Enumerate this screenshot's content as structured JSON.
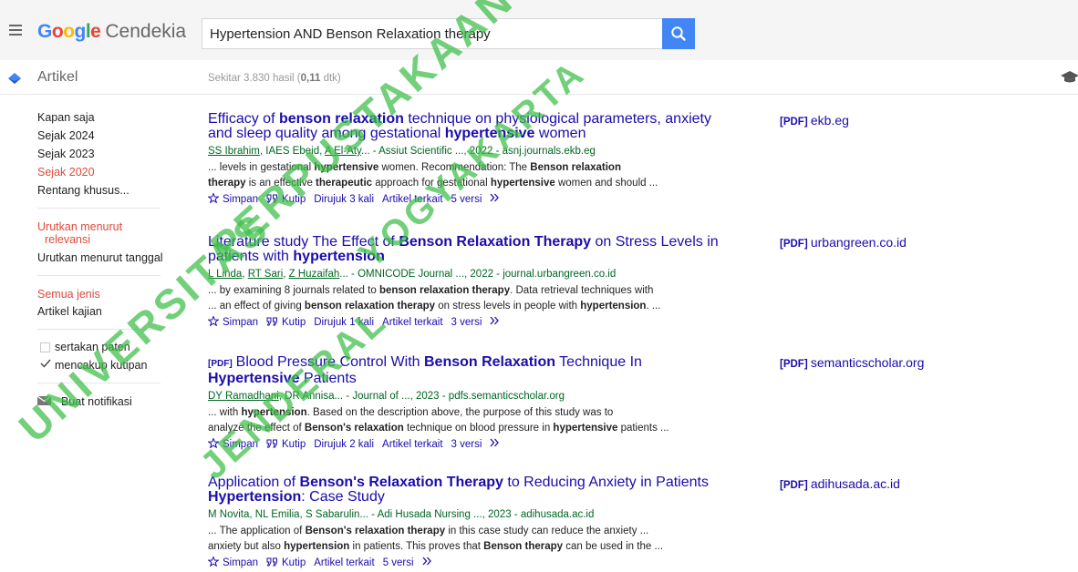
{
  "header": {
    "logo_text": "Google",
    "logo_suffix": "Cendekia",
    "search_value": "Hypertension AND Benson Relaxation therapy"
  },
  "subheader": {
    "section_label": "Artikel",
    "stats_prefix": "Sekitar 3.830 hasil (",
    "stats_time": "0,11",
    "stats_suffix": " dtk)"
  },
  "sidebar": {
    "time_filters": [
      "Kapan saja",
      "Sejak 2024",
      "Sejak 2023",
      "Sejak 2020",
      "Rentang khusus..."
    ],
    "sort_relevance_line1": "Urutkan menurut",
    "sort_relevance_line2": "relevansi",
    "sort_date": "Urutkan menurut tanggal",
    "type_all": "Semua jenis",
    "type_review": "Artikel kajian",
    "include_patents": "sertakan paten",
    "include_citations": "mencakup kutipan",
    "create_alert": "Buat notifikasi"
  },
  "watermark": {
    "line1": "UNIVERSITAS",
    "line2": "JENDERAL",
    "line3": "YOGYAKARTA",
    "line4": "PERPUSTAKAAN"
  },
  "results": [
    {
      "title_parts": [
        {
          "t": "Efficacy of ",
          "b": false
        },
        {
          "t": "benson relaxation",
          "b": true
        },
        {
          "t": " technique on physiological parameters, anxiety",
          "b": false
        }
      ],
      "title_line2_parts": [
        {
          "t": "and sleep quality among gestational ",
          "b": false
        },
        {
          "t": "hypertensive",
          "b": true
        },
        {
          "t": " women",
          "b": false
        }
      ],
      "authors": [
        "SS Ibrahim",
        "IAES Ebeid",
        "A El-Aty"
      ],
      "authors_rest": "... - Assiut Scientific ..., 2022 - asnj.journals.ekb.eg",
      "authors_linked": [
        true,
        false,
        true
      ],
      "snippet_line1": [
        {
          "t": "... levels in gestational ",
          "b": false
        },
        {
          "t": "hypertensive",
          "b": true
        },
        {
          "t": " women. Recommendation: The ",
          "b": false
        },
        {
          "t": "Benson relaxation",
          "b": true
        }
      ],
      "snippet_line2": [
        {
          "t": "therapy",
          "b": true
        },
        {
          "t": " is an effective ",
          "b": false
        },
        {
          "t": "therapeutic",
          "b": true
        },
        {
          "t": " approach for gestational ",
          "b": false
        },
        {
          "t": "hypertensive",
          "b": true
        },
        {
          "t": " women and should ...",
          "b": false
        }
      ],
      "actions": {
        "save": "Simpan",
        "cite": "Kutip",
        "cited_by": "Dirujuk 3 kali",
        "related": "Artikel terkait",
        "versions": "5 versi"
      },
      "side_tag": "[PDF]",
      "side_domain": "ekb.eg",
      "pdf_prefix": ""
    },
    {
      "title_parts": [
        {
          "t": "Literature study The Effect of ",
          "b": false
        },
        {
          "t": "Benson Relaxation Therapy",
          "b": true
        },
        {
          "t": " on Stress Levels in",
          "b": false
        }
      ],
      "title_line2_parts": [
        {
          "t": "patients with ",
          "b": false
        },
        {
          "t": "hypertension",
          "b": true
        }
      ],
      "authors": [
        "L Linda",
        "RT Sari",
        "Z Huzaifah"
      ],
      "authors_rest": "... - OMNICODE Journal ..., 2022 - journal.urbangreen.co.id",
      "authors_linked": [
        true,
        true,
        true
      ],
      "snippet_line1": [
        {
          "t": "... by examining 8 journals related to ",
          "b": false
        },
        {
          "t": "benson relaxation therapy",
          "b": true
        },
        {
          "t": ". Data retrieval techniques with",
          "b": false
        }
      ],
      "snippet_line2": [
        {
          "t": "... an effect of giving ",
          "b": false
        },
        {
          "t": "benson relaxation therapy",
          "b": true
        },
        {
          "t": " on stress levels in people with ",
          "b": false
        },
        {
          "t": "hypertension",
          "b": true
        },
        {
          "t": ". ...",
          "b": false
        }
      ],
      "actions": {
        "save": "Simpan",
        "cite": "Kutip",
        "cited_by": "Dirujuk 1 kali",
        "related": "Artikel terkait",
        "versions": "3 versi"
      },
      "side_tag": "[PDF]",
      "side_domain": "urbangreen.co.id",
      "pdf_prefix": ""
    },
    {
      "title_parts": [
        {
          "t": "Blood Pressure Control With ",
          "b": false
        },
        {
          "t": "Benson Relaxation",
          "b": true
        },
        {
          "t": " Technique In",
          "b": false
        }
      ],
      "title_line2_parts": [
        {
          "t": "Hypertensive",
          "b": true
        },
        {
          "t": " Patients",
          "b": false
        }
      ],
      "authors": [
        "DY Ramadhani",
        "DR Annisa"
      ],
      "authors_rest": "... - Journal of ..., 2023 - pdfs.semanticscholar.org",
      "authors_linked": [
        true,
        false
      ],
      "snippet_line1": [
        {
          "t": "... with ",
          "b": false
        },
        {
          "t": "hypertension",
          "b": true
        },
        {
          "t": ". Based on the description above, the purpose of this study was to",
          "b": false
        }
      ],
      "snippet_line2": [
        {
          "t": "analyze the effect of ",
          "b": false
        },
        {
          "t": "Benson's relaxation",
          "b": true
        },
        {
          "t": " technique on blood pressure in ",
          "b": false
        },
        {
          "t": "hypertensive",
          "b": true
        },
        {
          "t": " patients ...",
          "b": false
        }
      ],
      "actions": {
        "save": "Simpan",
        "cite": "Kutip",
        "cited_by": "Dirujuk 2 kali",
        "related": "Artikel terkait",
        "versions": "3 versi"
      },
      "side_tag": "[PDF]",
      "side_domain": "semanticscholar.org",
      "pdf_prefix": "[PDF]"
    },
    {
      "title_parts": [
        {
          "t": "Application of ",
          "b": false
        },
        {
          "t": "Benson's Relaxation Therapy",
          "b": true
        },
        {
          "t": " to Reducing Anxiety in Patients",
          "b": false
        }
      ],
      "title_line2_parts": [
        {
          "t": "Hypertension",
          "b": true
        },
        {
          "t": ": Case Study",
          "b": false
        }
      ],
      "authors": [
        "M Novita",
        "NL Emilia",
        "S Sabarulin"
      ],
      "authors_rest": "... - Adi Husada Nursing ..., 2023 - adihusada.ac.id",
      "authors_linked": [
        false,
        false,
        false
      ],
      "snippet_line1": [
        {
          "t": "... The application of ",
          "b": false
        },
        {
          "t": "Benson's relaxation therapy",
          "b": true
        },
        {
          "t": " in this case study can reduce the anxiety ...",
          "b": false
        }
      ],
      "snippet_line2": [
        {
          "t": "anxiety but also ",
          "b": false
        },
        {
          "t": "hypertension",
          "b": true
        },
        {
          "t": " in patients. This proves that ",
          "b": false
        },
        {
          "t": "Benson therapy",
          "b": true
        },
        {
          "t": " can be used in the ...",
          "b": false
        }
      ],
      "actions": {
        "save": "Simpan",
        "cite": "Kutip",
        "cited_by": "",
        "related": "Artikel terkait",
        "versions": "5 versi"
      },
      "side_tag": "[PDF]",
      "side_domain": "adihusada.ac.id",
      "pdf_prefix": ""
    }
  ],
  "colors": {
    "link": "#1a0dab",
    "author_green": "#006621",
    "active_red": "#dd4b39",
    "search_blue": "#4285f4",
    "watermark_green": "#3cbe46"
  },
  "icons": [
    "menu-icon",
    "search-icon",
    "articles-icon",
    "graduation-cap-icon",
    "star-icon",
    "quote-icon",
    "more-versions-icon",
    "mail-icon",
    "checkmark-icon"
  ]
}
